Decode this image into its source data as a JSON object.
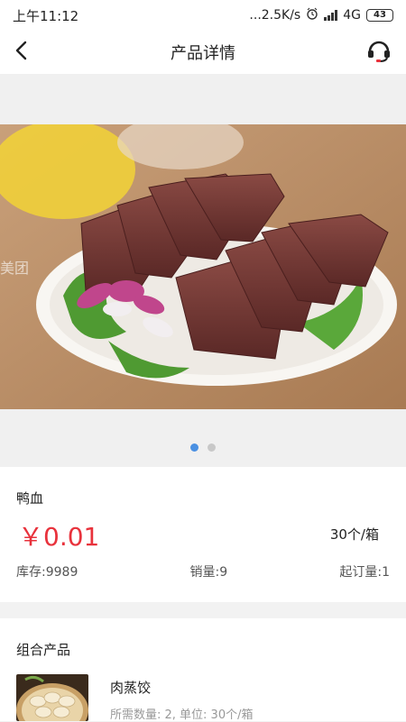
{
  "status_bar": {
    "time": "上午11:12",
    "network_speed": "...2.5K/s",
    "network_type": "4G",
    "battery": "43"
  },
  "nav": {
    "title": "产品详情",
    "back_icon": "chevron-left-icon",
    "service_icon": "headset-icon"
  },
  "carousel": {
    "image_subject": "duck blood",
    "watermark": "美团",
    "page_count": 2,
    "active_index": 0
  },
  "product": {
    "name": "鸭血",
    "price": "￥0.01",
    "unit": "30个/箱",
    "stock": "库存:9989",
    "sales": "销量:9",
    "min_order": "起订量:1"
  },
  "combo": {
    "title": "组合产品",
    "items": [
      {
        "name": "肉蒸饺",
        "desc": "所需数量: 2, 单位: 30个/箱"
      }
    ]
  },
  "colors": {
    "price": "#e8323c",
    "dot_active": "#4a90e2",
    "dot_inactive": "#c8c8c8",
    "page_background": "#f2f2f2"
  }
}
